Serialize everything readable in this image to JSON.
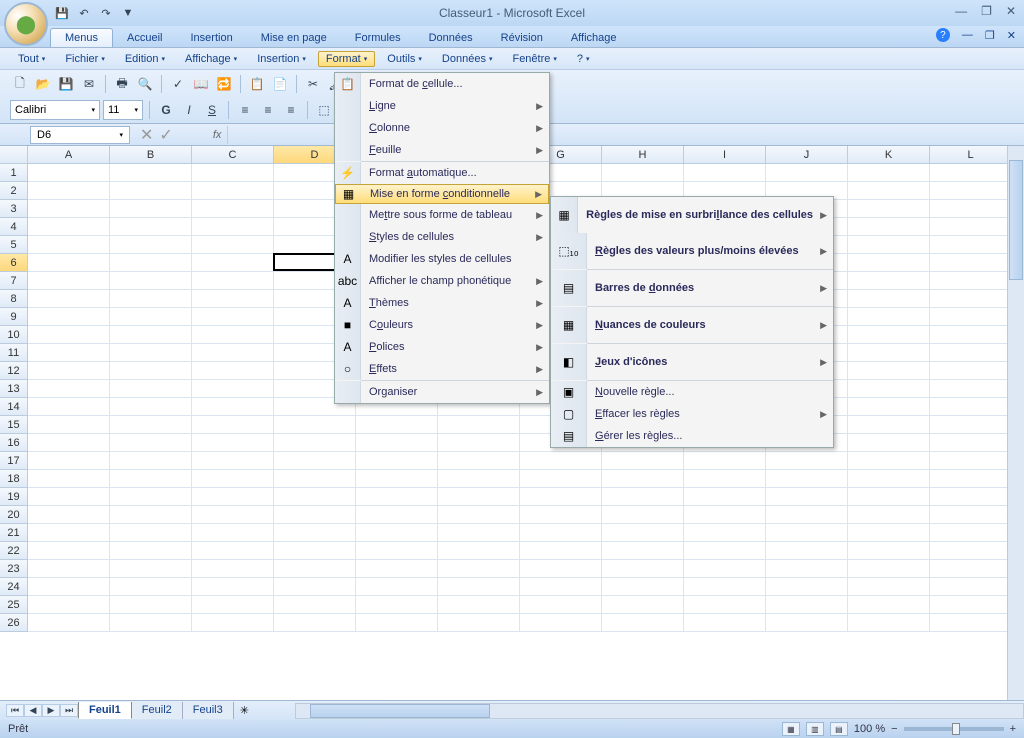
{
  "title": "Classeur1 - Microsoft Excel",
  "tabs": [
    "Menus",
    "Accueil",
    "Insertion",
    "Mise en page",
    "Formules",
    "Données",
    "Révision",
    "Affichage"
  ],
  "active_tab": 0,
  "menus": [
    "Tout",
    "Fichier",
    "Edition",
    "Affichage",
    "Insertion",
    "Format",
    "Outils",
    "Données",
    "Fenêtre",
    "?"
  ],
  "active_menu": 5,
  "font": {
    "name": "Calibri",
    "size": "11"
  },
  "namebox": "D6",
  "columns": [
    "A",
    "B",
    "C",
    "D",
    "E",
    "F",
    "G",
    "H",
    "I",
    "J",
    "K",
    "L"
  ],
  "rows": 26,
  "selected_col": 3,
  "selected_row": 5,
  "format_menu": [
    {
      "label": "Format de cellule...",
      "u": 10,
      "icon": "📋",
      "arrow": false
    },
    {
      "label": "Ligne",
      "u": 0,
      "arrow": true
    },
    {
      "label": "Colonne",
      "u": 0,
      "arrow": true
    },
    {
      "label": "Feuille",
      "u": 0,
      "arrow": true
    },
    {
      "sep": true
    },
    {
      "label": "Format automatique...",
      "u": 7,
      "icon": "⚡"
    },
    {
      "label": "Mise en forme conditionnelle",
      "u": 14,
      "icon": "▦",
      "arrow": true,
      "hover": true
    },
    {
      "label": "Mettre sous forme de tableau",
      "u": 2,
      "arrow": true
    },
    {
      "label": "Styles de cellules",
      "u": 0,
      "arrow": true
    },
    {
      "label": "Modifier les styles de cellules",
      "icon": "A"
    },
    {
      "label": "Afficher le champ phonétique",
      "icon": "abc",
      "arrow": true
    },
    {
      "label": "Thèmes",
      "u": 0,
      "icon": "A",
      "arrow": true
    },
    {
      "label": "Couleurs",
      "u": 1,
      "icon": "■",
      "arrow": true
    },
    {
      "label": "Polices",
      "u": 0,
      "icon": "A",
      "arrow": true
    },
    {
      "label": "Effets",
      "u": 0,
      "icon": "○",
      "arrow": true
    },
    {
      "sep": true
    },
    {
      "label": "Organiser",
      "arrow": true
    }
  ],
  "cond_menu": [
    {
      "label": "Règles de mise en surbrillance des cellules",
      "u": 24,
      "icon": "▦",
      "arrow": true,
      "tall": true,
      "bold": true
    },
    {
      "label": "Règles des valeurs plus/moins élevées",
      "u": 0,
      "icon": "⬚₁₀",
      "arrow": true,
      "tall": true,
      "bold": true
    },
    {
      "sep": true
    },
    {
      "label": "Barres de données",
      "u": 10,
      "icon": "▤",
      "arrow": true,
      "tall": true,
      "bold": true
    },
    {
      "sep": true
    },
    {
      "label": "Nuances de couleurs",
      "u": 0,
      "icon": "▦",
      "arrow": true,
      "tall": true,
      "bold": true
    },
    {
      "sep": true
    },
    {
      "label": "Jeux d'icônes",
      "u": 0,
      "icon": "◧",
      "arrow": true,
      "tall": true,
      "bold": true
    },
    {
      "sep": true
    },
    {
      "label": "Nouvelle règle...",
      "u": 0,
      "icon": "▣"
    },
    {
      "label": "Effacer les règles",
      "u": 0,
      "icon": "▢",
      "arrow": true
    },
    {
      "label": "Gérer les règles...",
      "u": 0,
      "icon": "▤"
    }
  ],
  "sheets": [
    "Feuil1",
    "Feuil2",
    "Feuil3"
  ],
  "active_sheet": 0,
  "status": "Prêt",
  "zoom": "100 %"
}
